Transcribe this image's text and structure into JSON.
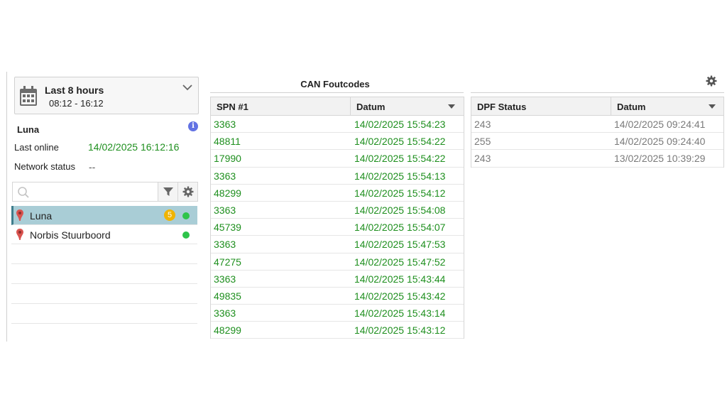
{
  "time_selector": {
    "title": "Last 8 hours",
    "range": "08:12 - 16:12"
  },
  "vehicle": {
    "name": "Luna",
    "last_online_label": "Last online",
    "last_online_value": "14/02/2025 16:12:16",
    "network_status_label": "Network status",
    "network_status_value": "--"
  },
  "search": {
    "placeholder": ""
  },
  "vehicle_list": [
    {
      "name": "Luna",
      "badge": "5",
      "selected": true,
      "status_color": "#2ec44a"
    },
    {
      "name": "Norbis Stuurboord",
      "badge": "",
      "selected": false,
      "status_color": "#2ec44a"
    }
  ],
  "can_table": {
    "title": "CAN Foutcodes",
    "columns": [
      "SPN #1",
      "Datum"
    ],
    "rows": [
      [
        "3363",
        "14/02/2025 15:54:23"
      ],
      [
        "48811",
        "14/02/2025 15:54:22"
      ],
      [
        "17990",
        "14/02/2025 15:54:22"
      ],
      [
        "3363",
        "14/02/2025 15:54:13"
      ],
      [
        "48299",
        "14/02/2025 15:54:12"
      ],
      [
        "3363",
        "14/02/2025 15:54:08"
      ],
      [
        "45739",
        "14/02/2025 15:54:07"
      ],
      [
        "3363",
        "14/02/2025 15:47:53"
      ],
      [
        "47275",
        "14/02/2025 15:47:52"
      ],
      [
        "3363",
        "14/02/2025 15:43:44"
      ],
      [
        "49835",
        "14/02/2025 15:43:42"
      ],
      [
        "3363",
        "14/02/2025 15:43:14"
      ],
      [
        "48299",
        "14/02/2025 15:43:12"
      ]
    ]
  },
  "dpf_table": {
    "columns": [
      "DPF Status",
      "Datum"
    ],
    "rows": [
      [
        "243",
        "14/02/2025 09:24:41"
      ],
      [
        "255",
        "14/02/2025 09:24:40"
      ],
      [
        "243",
        "13/02/2025 10:39:29"
      ]
    ]
  },
  "colors": {
    "online_green": "#2ec44a",
    "can_text": "#1e8f1e",
    "dpf_text": "#7a7a7a",
    "selected_row": "#a9cdd6",
    "badge": "#f0b400",
    "info": "#6272e3"
  }
}
